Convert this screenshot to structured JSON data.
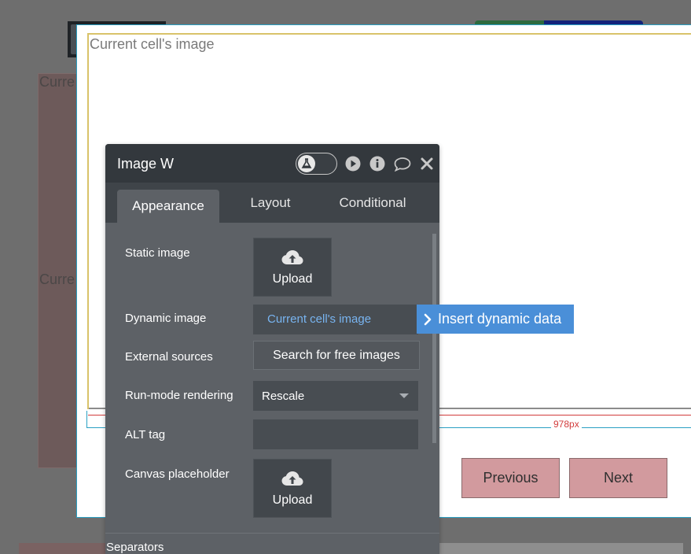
{
  "background": {
    "group_label": "Curre"
  },
  "popup": {
    "image_label": "Current cell's image",
    "width_label": "978px",
    "previous_label": "Previous",
    "next_label": "Next"
  },
  "editor": {
    "title": "Image W",
    "tabs": [
      {
        "label": "Appearance",
        "active": true
      },
      {
        "label": "Layout",
        "active": false
      },
      {
        "label": "Conditional",
        "active": false
      }
    ],
    "props": {
      "static_image": "Static image",
      "dynamic_image": "Dynamic image",
      "dynamic_value": "Current cell's image",
      "external_sources": "External sources",
      "free_images_label": "Search for free images",
      "run_mode": "Run-mode rendering",
      "run_mode_value": "Rescale",
      "alt_tag": "ALT tag",
      "alt_tag_value": "",
      "canvas_placeholder": "Canvas placeholder",
      "upload_label": "Upload"
    },
    "separators_label": "Separators",
    "insert_dynamic_label": "Insert dynamic data",
    "icons": [
      "flask-icon",
      "play-icon",
      "info-icon",
      "comment-icon",
      "close-icon",
      "upload-cloud-icon",
      "chevron-right-icon"
    ],
    "colors": {
      "accent": "#4a8fd8",
      "link": "#78b4f0",
      "header": "#33383d",
      "panel": "#5d6166"
    }
  }
}
